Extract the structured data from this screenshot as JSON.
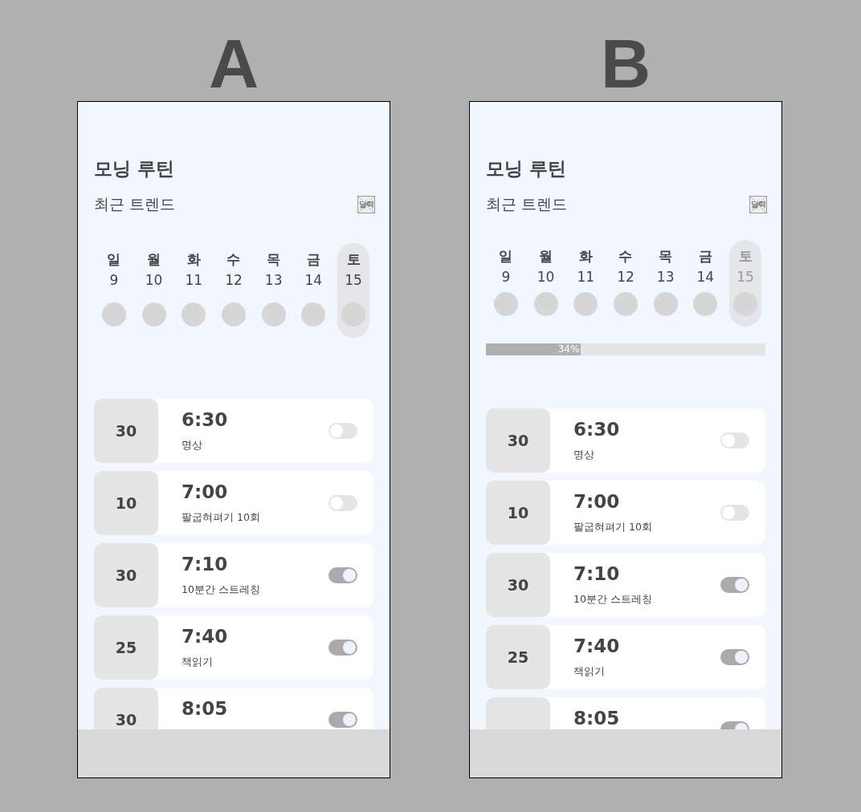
{
  "panels": [
    {
      "label": "A",
      "title": "모닝 루틴",
      "subtitle": "최근 트렌드",
      "calendar_label": "달력",
      "days": [
        {
          "weekday": "일",
          "date": "9",
          "selected": false,
          "disabled": false
        },
        {
          "weekday": "월",
          "date": "10",
          "selected": false,
          "disabled": false
        },
        {
          "weekday": "화",
          "date": "11",
          "selected": false,
          "disabled": false
        },
        {
          "weekday": "수",
          "date": "12",
          "selected": false,
          "disabled": false
        },
        {
          "weekday": "목",
          "date": "13",
          "selected": false,
          "disabled": false
        },
        {
          "weekday": "금",
          "date": "14",
          "selected": false,
          "disabled": false
        },
        {
          "weekday": "토",
          "date": "15",
          "selected": true,
          "disabled": false
        }
      ],
      "routines": [
        {
          "minutes": "30",
          "time": "6:30",
          "name": "명상",
          "on": false
        },
        {
          "minutes": "10",
          "time": "7:00",
          "name": "팔굽혀펴기 10회",
          "on": false
        },
        {
          "minutes": "30",
          "time": "7:10",
          "name": "10분간 스트레칭",
          "on": true
        },
        {
          "minutes": "25",
          "time": "7:40",
          "name": "책읽기",
          "on": true
        },
        {
          "minutes": "30",
          "time": "8:05",
          "on": true
        }
      ]
    },
    {
      "label": "B",
      "title": "모닝 루틴",
      "subtitle": "최근 트렌드",
      "calendar_label": "달력",
      "days": [
        {
          "weekday": "일",
          "date": "9",
          "selected": false,
          "disabled": false
        },
        {
          "weekday": "월",
          "date": "10",
          "selected": false,
          "disabled": false
        },
        {
          "weekday": "화",
          "date": "11",
          "selected": false,
          "disabled": false
        },
        {
          "weekday": "수",
          "date": "12",
          "selected": false,
          "disabled": false
        },
        {
          "weekday": "목",
          "date": "13",
          "selected": false,
          "disabled": false
        },
        {
          "weekday": "금",
          "date": "14",
          "selected": false,
          "disabled": false
        },
        {
          "weekday": "토",
          "date": "15",
          "selected": true,
          "disabled": true
        }
      ],
      "progress": {
        "level": 0.34,
        "reading": "34%"
      },
      "routines": [
        {
          "minutes": "30",
          "time": "6:30",
          "name": "명상",
          "on": false
        },
        {
          "minutes": "10",
          "time": "7:00",
          "name": "팔굽혀펴기 10회",
          "on": false
        },
        {
          "minutes": "30",
          "time": "7:10",
          "name": "10분간 스트레칭",
          "on": true
        },
        {
          "minutes": "25",
          "time": "7:40",
          "name": "책읽기",
          "on": true
        },
        {
          "time": "8:05",
          "on": true
        }
      ]
    }
  ]
}
